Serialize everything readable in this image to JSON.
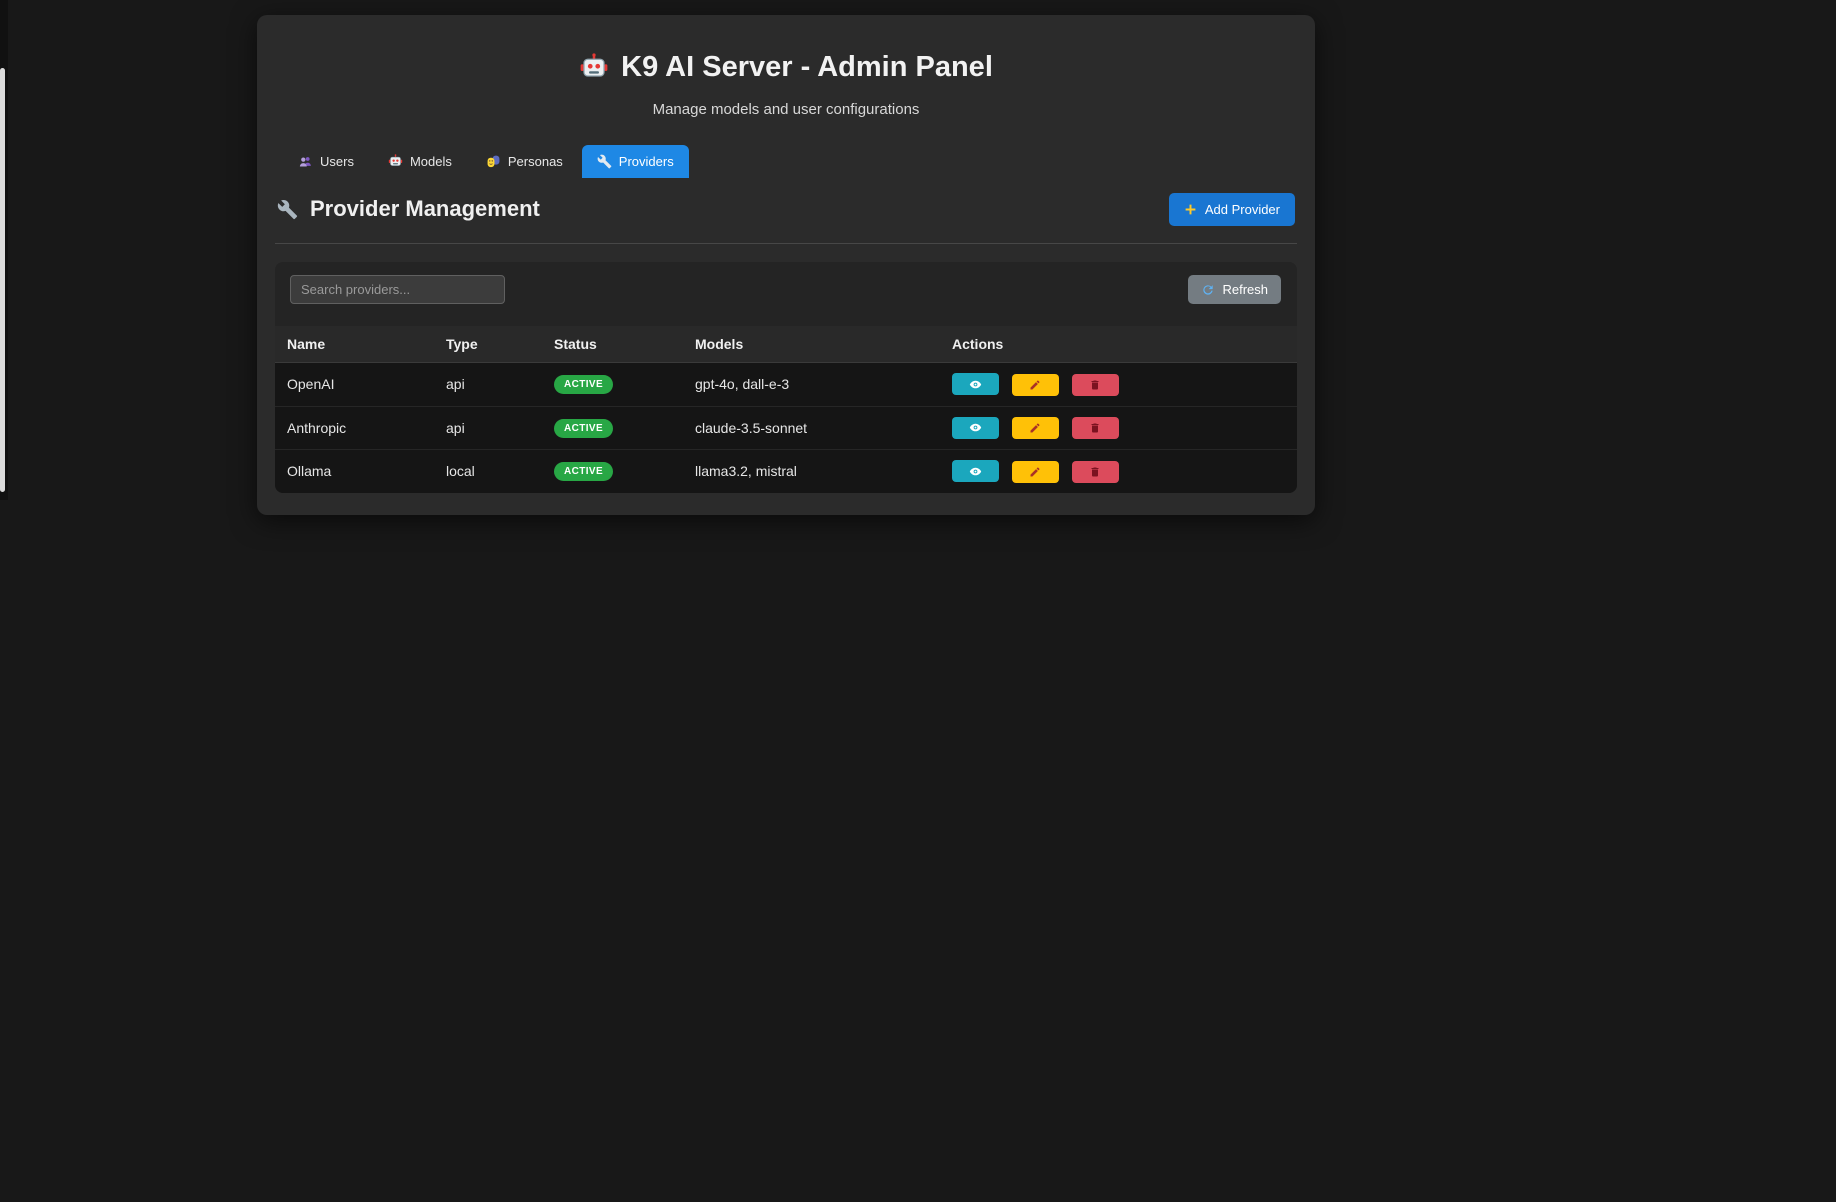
{
  "page": {
    "title": "K9 AI Server - Admin Panel",
    "subtitle": "Manage models and user configurations"
  },
  "tabs": [
    {
      "label": "Users",
      "icon": "users-icon",
      "active": false
    },
    {
      "label": "Models",
      "icon": "robot-icon",
      "active": false
    },
    {
      "label": "Personas",
      "icon": "masks-icon",
      "active": false
    },
    {
      "label": "Providers",
      "icon": "wrench-icon",
      "active": true
    }
  ],
  "section": {
    "title": "Provider Management",
    "add_button_label": "Add Provider",
    "add_button_icon": "plus-icon",
    "title_icon": "wrench-icon"
  },
  "toolbar": {
    "search_placeholder": "Search providers...",
    "refresh_label": "Refresh",
    "refresh_icon": "refresh-icon"
  },
  "table": {
    "headers": [
      "Name",
      "Type",
      "Status",
      "Models",
      "Actions"
    ],
    "rows": [
      {
        "name": "OpenAI",
        "type": "api",
        "status": "ACTIVE",
        "models": "gpt-4o, dall-e-3",
        "actions": [
          "eye-icon",
          "pencil-icon",
          "trash-icon"
        ]
      },
      {
        "name": "Anthropic",
        "type": "api",
        "status": "ACTIVE",
        "models": "claude-3.5-sonnet",
        "actions": [
          "eye-icon",
          "pencil-icon",
          "trash-icon"
        ]
      },
      {
        "name": "Ollama",
        "type": "local",
        "status": "ACTIVE",
        "models": "llama3.2, mistral",
        "actions": [
          "eye-icon",
          "pencil-icon",
          "trash-icon"
        ]
      }
    ]
  },
  "colors": {
    "active_tab": "#1e88e5",
    "add_button": "#1976d2",
    "refresh_button": "#747c82",
    "status_active": "#28a745",
    "view_button": "#1ba7bd",
    "edit_button": "#ffc107",
    "delete_button": "#dc4b5c",
    "card_background": "#2b2b2b",
    "page_background": "#181818"
  }
}
